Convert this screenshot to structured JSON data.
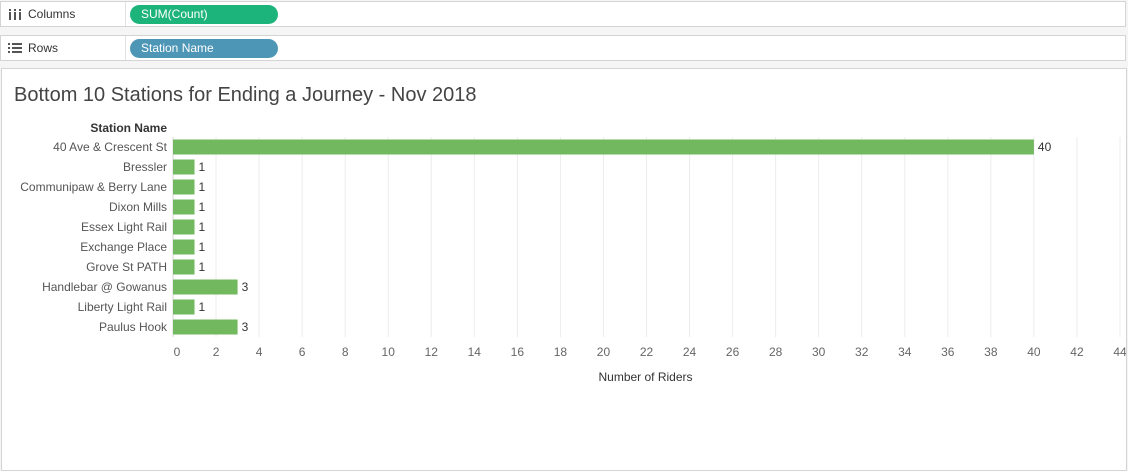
{
  "shelves": {
    "columns": {
      "label": "Columns",
      "pill": "SUM(Count)"
    },
    "rows": {
      "label": "Rows",
      "pill": "Station Name"
    }
  },
  "colors": {
    "bar": "#72b85f",
    "columns_pill": "#1db47b",
    "rows_pill": "#4e96b6"
  },
  "chart_data": {
    "type": "bar",
    "orientation": "horizontal",
    "title": "Bottom 10 Stations for Ending a Journey - Nov 2018",
    "row_header": "Station Name",
    "xlabel": "Number of Riders",
    "categories": [
      "40 Ave & Crescent St",
      "Bressler",
      "Communipaw & Berry Lane",
      "Dixon Mills",
      "Essex Light Rail",
      "Exchange Place",
      "Grove St PATH",
      "Handlebar @ Gowanus",
      "Liberty Light Rail",
      "Paulus Hook"
    ],
    "values": [
      40,
      1,
      1,
      1,
      1,
      1,
      1,
      3,
      1,
      3
    ],
    "xlim": [
      0,
      44
    ],
    "xticks": [
      0,
      2,
      4,
      6,
      8,
      10,
      12,
      14,
      16,
      18,
      20,
      22,
      24,
      26,
      28,
      30,
      32,
      34,
      36,
      38,
      40,
      42,
      44
    ],
    "grid": true,
    "data_labels": true
  }
}
